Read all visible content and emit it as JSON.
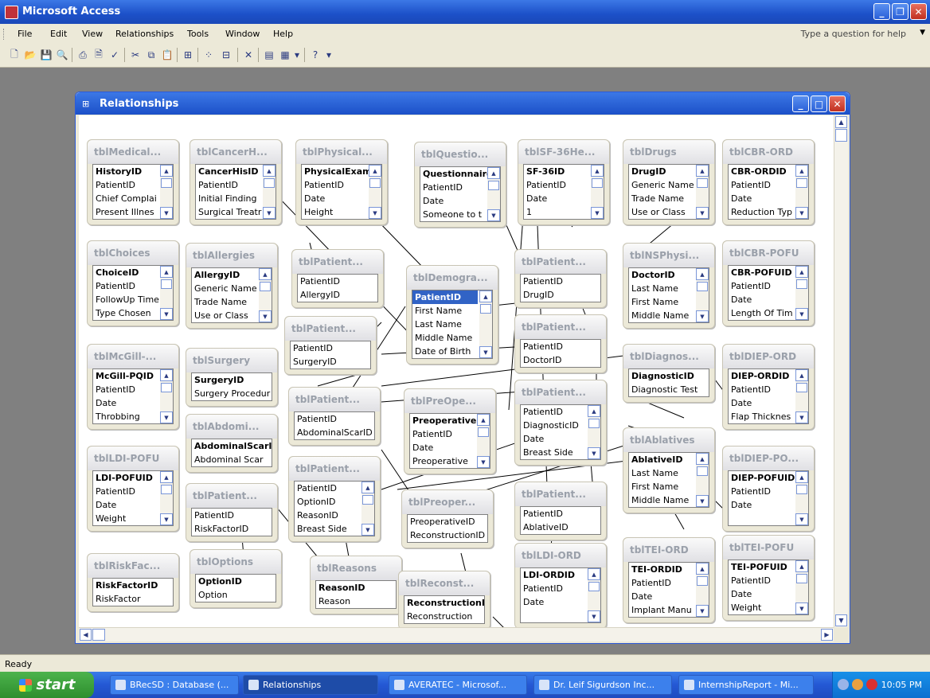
{
  "app": {
    "title": "Microsoft Access"
  },
  "menu": [
    "File",
    "Edit",
    "View",
    "Relationships",
    "Tools",
    "Window",
    "Help"
  ],
  "help_box": {
    "placeholder": "Type a question for help"
  },
  "relationships_window": {
    "title": "Relationships"
  },
  "tables": [
    {
      "id": "t1",
      "title": "tblMedical...",
      "fields": [
        "HistoryID",
        "PatientID",
        "Chief Complai",
        "Present Illnes"
      ],
      "pk": 0
    },
    {
      "id": "t2",
      "title": "tblCancerH...",
      "fields": [
        "CancerHisID",
        "PatientID",
        "Initial Finding",
        "Surgical Treatr"
      ],
      "pk": 0
    },
    {
      "id": "t3",
      "title": "tblPhysical...",
      "fields": [
        "PhysicalExamI",
        "PatientID",
        "Date",
        "Height"
      ],
      "pk": 0
    },
    {
      "id": "t4",
      "title": "tblQuestio...",
      "fields": [
        "Questionnaire",
        "PatientID",
        "Date",
        "Someone to t"
      ],
      "pk": 0
    },
    {
      "id": "t5",
      "title": "tblSF-36He...",
      "fields": [
        "SF-36ID",
        "PatientID",
        "Date",
        "1"
      ],
      "pk": 0
    },
    {
      "id": "t6",
      "title": "tblDrugs",
      "fields": [
        "DrugID",
        "Generic Name",
        "Trade Name",
        "Use or Class"
      ],
      "pk": 0
    },
    {
      "id": "t7",
      "title": "tblCBR-ORD",
      "fields": [
        "CBR-ORDID",
        "PatientID",
        "Date",
        "Reduction Typ"
      ],
      "pk": 0
    },
    {
      "id": "t8",
      "title": "tblChoices",
      "fields": [
        "ChoiceID",
        "PatientID",
        "FollowUp Time",
        "Type Chosen"
      ],
      "pk": 0
    },
    {
      "id": "t9",
      "title": "tblAllergies",
      "fields": [
        "AllergyID",
        "Generic Name",
        "Trade Name",
        "Use or Class"
      ],
      "pk": 0
    },
    {
      "id": "t10",
      "title": "tblPatient...",
      "fields": [
        "PatientID",
        "AllergyID"
      ],
      "pk": -1
    },
    {
      "id": "t11",
      "title": "tblDemogra...",
      "fields": [
        "PatientID",
        "First Name",
        "Last Name",
        "Middle Name",
        "Date of Birth"
      ],
      "pk": 0,
      "sel": 0
    },
    {
      "id": "t12",
      "title": "tblPatient...",
      "fields": [
        "PatientID",
        "DrugID"
      ],
      "pk": -1
    },
    {
      "id": "t13",
      "title": "tblNSPhysi...",
      "fields": [
        "DoctorID",
        "Last Name",
        "First Name",
        "Middle Name"
      ],
      "pk": 0
    },
    {
      "id": "t14",
      "title": "tblCBR-POFU",
      "fields": [
        "CBR-POFUID",
        "PatientID",
        "Date",
        "Length Of Tim"
      ],
      "pk": 0
    },
    {
      "id": "t15",
      "title": "tblPatient...",
      "fields": [
        "PatientID",
        "SurgeryID"
      ],
      "pk": -1
    },
    {
      "id": "t16",
      "title": "tblPatient...",
      "fields": [
        "PatientID",
        "DoctorID"
      ],
      "pk": -1
    },
    {
      "id": "t17",
      "title": "tblMcGill-...",
      "fields": [
        "McGill-PQID",
        "PatientID",
        "Date",
        "Throbbing"
      ],
      "pk": 0
    },
    {
      "id": "t18",
      "title": "tblSurgery",
      "fields": [
        "SurgeryID",
        "Surgery Procedur"
      ],
      "pk": 0
    },
    {
      "id": "t19",
      "title": "tblDiagnos...",
      "fields": [
        "DiagnosticID",
        "Diagnostic Test"
      ],
      "pk": 0
    },
    {
      "id": "t20",
      "title": "tblDIEP-ORD",
      "fields": [
        "DIEP-ORDID",
        "PatientID",
        "Date",
        "Flap Thicknes"
      ],
      "pk": 0
    },
    {
      "id": "t21",
      "title": "tblPatient...",
      "fields": [
        "PatientID",
        "AbdominalScarID"
      ],
      "pk": -1
    },
    {
      "id": "t22",
      "title": "tblPreOpe...",
      "fields": [
        "PreoperativeI",
        "PatientID",
        "Date",
        "Preoperative"
      ],
      "pk": 0
    },
    {
      "id": "t23",
      "title": "tblPatient...",
      "fields": [
        "PatientID",
        "DiagnosticID",
        "Date",
        "Breast Side"
      ],
      "pk": -1
    },
    {
      "id": "t24",
      "title": "tblAbdomi...",
      "fields": [
        "AbdominalScarID",
        "Abdominal Scar"
      ],
      "pk": 0
    },
    {
      "id": "t25",
      "title": "tblAblatives",
      "fields": [
        "AblativeID",
        "Last Name",
        "First Name",
        "Middle Name"
      ],
      "pk": 0
    },
    {
      "id": "t26",
      "title": "tblLDI-POFU",
      "fields": [
        "LDI-POFUID",
        "PatientID",
        "Date",
        "Weight"
      ],
      "pk": 0
    },
    {
      "id": "t27",
      "title": "tblPatient...",
      "fields": [
        "PatientID",
        "OptionID",
        "ReasonID",
        "Breast Side"
      ],
      "pk": -1
    },
    {
      "id": "t28",
      "title": "tblDIEP-PO...",
      "fields": [
        "DIEP-POFUID",
        "PatientID",
        "Date"
      ],
      "pk": 0
    },
    {
      "id": "t29",
      "title": "tblPatient...",
      "fields": [
        "PatientID",
        "RiskFactorID"
      ],
      "pk": -1
    },
    {
      "id": "t30",
      "title": "tblPreoper...",
      "fields": [
        "PreoperativeID",
        "ReconstructionID"
      ],
      "pk": -1
    },
    {
      "id": "t31",
      "title": "tblPatient...",
      "fields": [
        "PatientID",
        "AblativeID"
      ],
      "pk": -1
    },
    {
      "id": "t32",
      "title": "tblLDI-ORD",
      "fields": [
        "LDI-ORDID",
        "PatientID",
        "Date"
      ],
      "pk": 0
    },
    {
      "id": "t33",
      "title": "tblTEI-ORD",
      "fields": [
        "TEI-ORDID",
        "PatientID",
        "Date",
        "Implant Manu"
      ],
      "pk": 0
    },
    {
      "id": "t34",
      "title": "tblTEI-POFU",
      "fields": [
        "TEI-POFUID",
        "PatientID",
        "Date",
        "Weight"
      ],
      "pk": 0
    },
    {
      "id": "t35",
      "title": "tblRiskFac...",
      "fields": [
        "RiskFactorID",
        "RiskFactor"
      ],
      "pk": 0
    },
    {
      "id": "t36",
      "title": "tblOptions",
      "fields": [
        "OptionID",
        "Option"
      ],
      "pk": 0
    },
    {
      "id": "t37",
      "title": "tblReasons",
      "fields": [
        "ReasonID",
        "Reason"
      ],
      "pk": 0
    },
    {
      "id": "t38",
      "title": "tblReconst...",
      "fields": [
        "ReconstructionID",
        "Reconstruction"
      ],
      "pk": 0
    }
  ],
  "status": {
    "text": "Ready"
  },
  "taskbar": {
    "start_label": "start",
    "items": [
      {
        "label": "BRecSD : Database (..."
      },
      {
        "label": "Relationships"
      },
      {
        "label": "AVERATEC - Microsof..."
      },
      {
        "label": "Dr. Leif Sigurdson Inc..."
      },
      {
        "label": "InternshipReport - Mi..."
      }
    ],
    "clock": "10:05 PM"
  }
}
